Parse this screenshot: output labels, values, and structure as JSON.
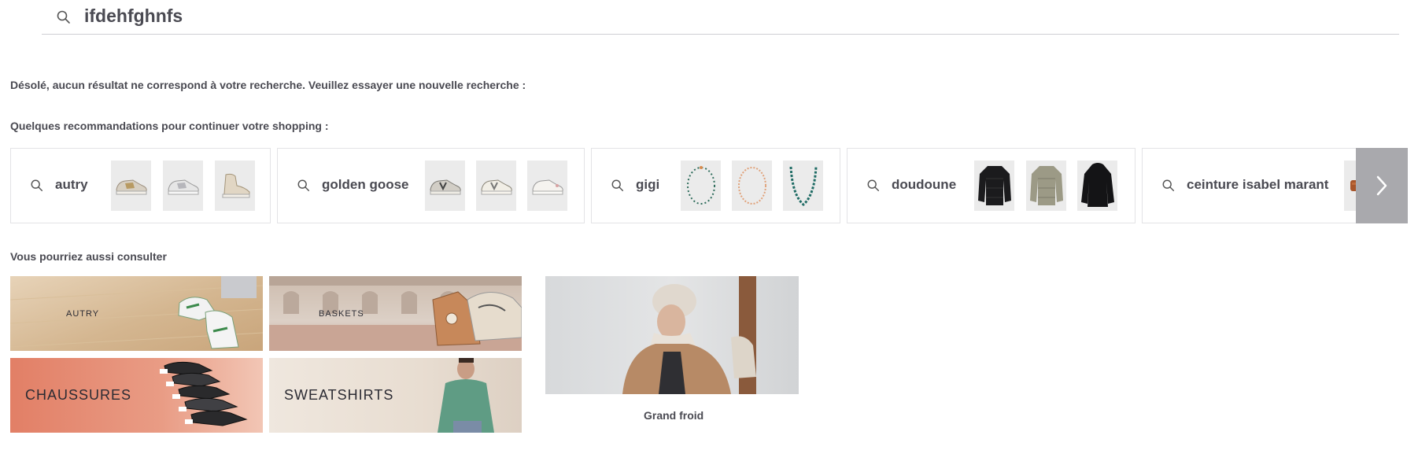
{
  "search": {
    "value": "ifdehfghnfs",
    "icon": "search-icon"
  },
  "messages": {
    "no_results": "Désolé, aucun résultat ne correspond à votre recherche. Veuillez essayer une nouvelle recherche :",
    "recommendations_heading": "Quelques recommandations pour continuer votre shopping :",
    "also_see_heading": "Vous pourriez aussi consulter"
  },
  "recommendations": [
    {
      "term": "autry",
      "thumbs": [
        "sneaker-gold",
        "sneaker-silver",
        "sneaker-beige-high"
      ]
    },
    {
      "term": "golden goose",
      "thumbs": [
        "sneaker-grey",
        "sneaker-white-star",
        "sneaker-white"
      ]
    },
    {
      "term": "gigi",
      "thumbs": [
        "necklace-green",
        "necklace-orange",
        "necklace-teal"
      ]
    },
    {
      "term": "doudoune",
      "thumbs": [
        "puffer-black",
        "puffer-metallic",
        "parka-black"
      ]
    },
    {
      "term": "ceinture isabel marant",
      "thumbs": [
        "belt-brown"
      ]
    }
  ],
  "categories": [
    {
      "label": "AUTRY",
      "image": "sneakers-on-wood-floor"
    },
    {
      "label": "BASKETS",
      "image": "sneakers-in-arcade"
    },
    {
      "label": "CHAUSSURES",
      "image": "shoes-on-orange"
    },
    {
      "label": "SWEATSHIRTS",
      "image": "man-in-green-sweatshirt"
    }
  ],
  "feature": {
    "label": "Grand froid",
    "image": "woman-in-winter-coat"
  },
  "colors": {
    "text": "#4a4a52",
    "border": "#e3e3e6",
    "arrow_bg": "#a9a9ad"
  }
}
